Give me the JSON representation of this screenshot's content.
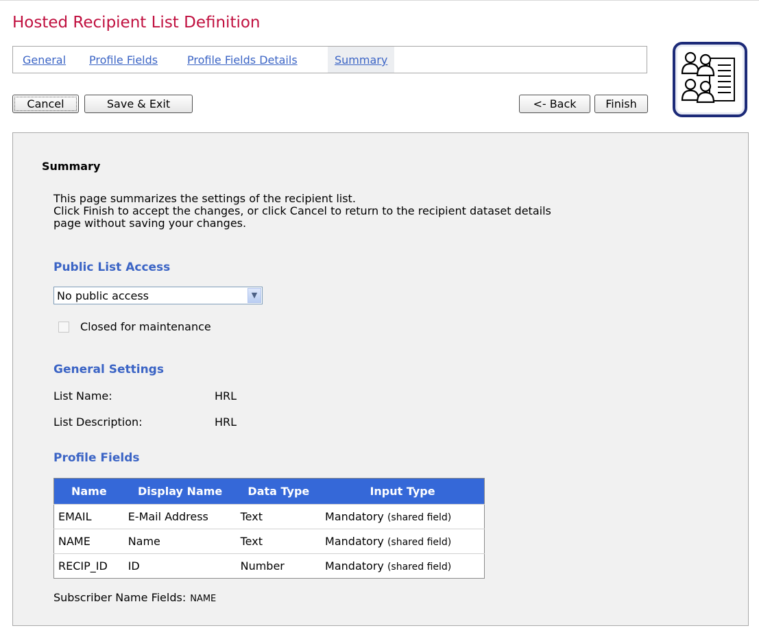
{
  "header": {
    "title": "Hosted Recipient List Definition"
  },
  "tabs": [
    {
      "label": "General"
    },
    {
      "label": "Profile Fields"
    },
    {
      "label": "Profile Fields Details"
    },
    {
      "label": "Summary"
    }
  ],
  "toolbar": {
    "cancel_label": "Cancel",
    "save_exit_label": "Save & Exit",
    "back_label": "<- Back",
    "finish_label": "Finish"
  },
  "summary": {
    "heading": "Summary",
    "intro": [
      "This page summarizes the settings of the recipient list.",
      "Click Finish to accept the changes, or click Cancel to return to the recipient dataset details",
      "page without saving your changes."
    ]
  },
  "public_access": {
    "heading": "Public List Access",
    "selected": "No public access",
    "maintenance_label": "Closed for maintenance",
    "maintenance_checked": false
  },
  "general_settings": {
    "heading": "General Settings",
    "list_name_label": "List Name:",
    "list_name_value": "HRL",
    "list_description_label": "List Description:",
    "list_description_value": "HRL"
  },
  "profile_fields": {
    "heading": "Profile Fields",
    "columns": [
      "Name",
      "Display Name",
      "Data Type",
      "Input Type"
    ],
    "rows": [
      [
        "EMAIL",
        "E-Mail Address",
        "Text",
        "Mandatory",
        "(shared field)"
      ],
      [
        "NAME",
        "Name",
        "Text",
        "Mandatory",
        "(shared field)"
      ],
      [
        "RECIP_ID",
        "ID",
        "Number",
        "Mandatory",
        "(shared field)"
      ]
    ],
    "subscriber_label": "Subscriber Name Fields:",
    "subscriber_value": "NAME"
  },
  "colors": {
    "title": "#c0103f",
    "link": "#3b64c5",
    "table_header": "#3568d8",
    "logo_border": "#1c2a78"
  },
  "icons": {
    "logo": "recipient-list-icon"
  }
}
